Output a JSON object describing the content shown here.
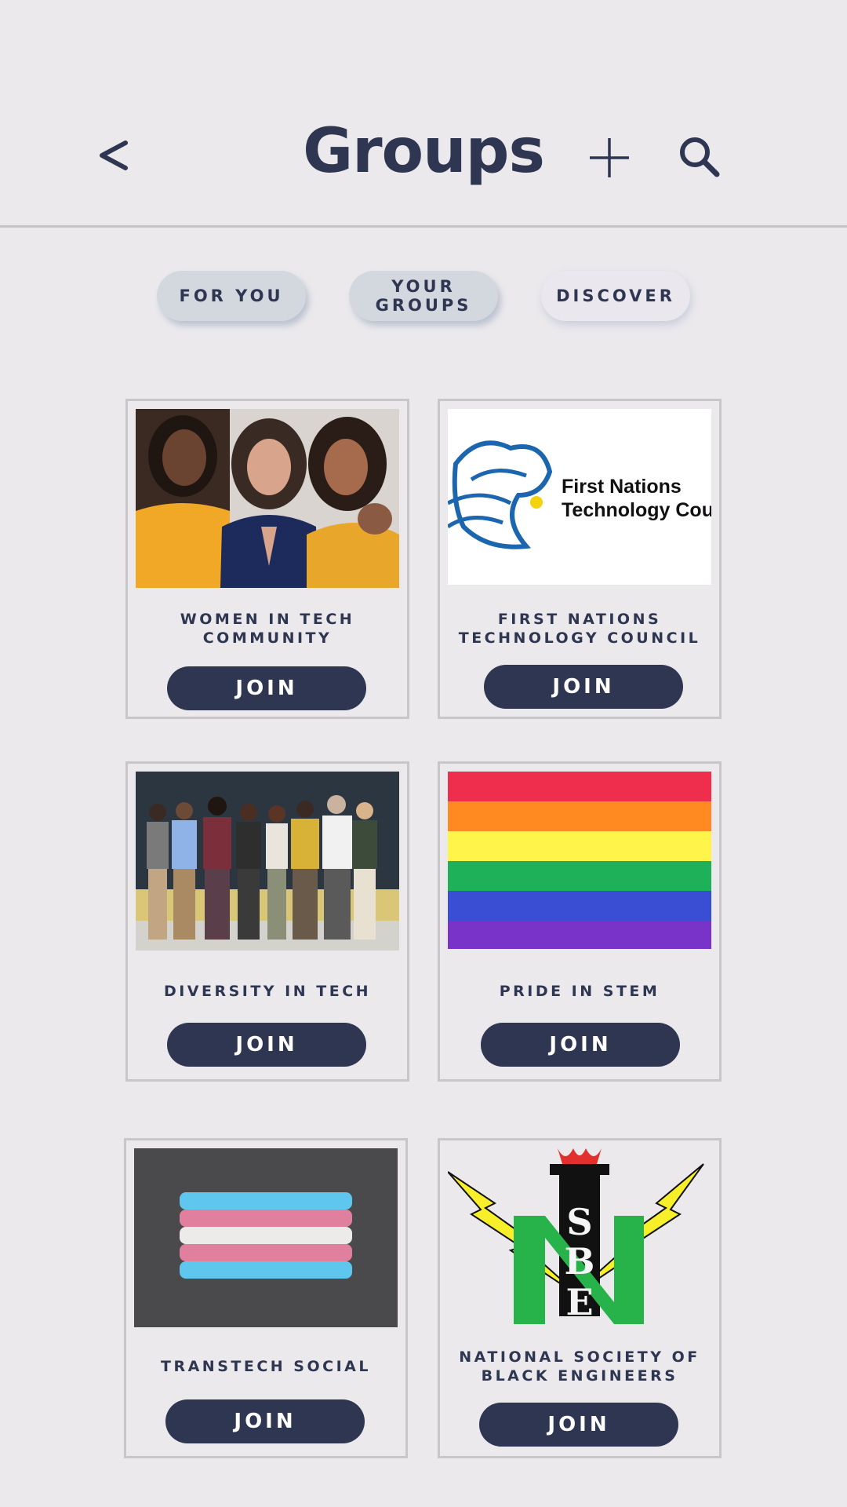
{
  "header": {
    "title": "Groups",
    "back_icon": "chevron-left-icon",
    "add_icon": "plus-icon",
    "search_icon": "search-icon"
  },
  "tabs": [
    {
      "label": "FOR YOU",
      "active": false
    },
    {
      "label": "YOUR\nGROUPS",
      "active": false
    },
    {
      "label": "DISCOVER",
      "active": true
    }
  ],
  "groups": [
    {
      "name": "WOMEN IN TECH\nCOMMUNITY",
      "join_label": "JOIN"
    },
    {
      "name": "FIRST NATIONS\nTECHNOLOGY COUNCIL",
      "join_label": "JOIN",
      "logo_text_1": "First Nations",
      "logo_text_2": "Technology Cou"
    },
    {
      "name": "DIVERSITY IN TECH",
      "join_label": "JOIN"
    },
    {
      "name": "PRIDE IN STEM",
      "join_label": "JOIN"
    },
    {
      "name": "TRANSTECH SOCIAL",
      "join_label": "JOIN"
    },
    {
      "name": "NATIONAL SOCIETY OF\nBLACK ENGINEERS",
      "join_label": "JOIN",
      "logo_letters": [
        "S",
        "B",
        "E"
      ],
      "logo_big_letter": "N"
    }
  ],
  "colors": {
    "background": "#ebe9ec",
    "primary": "#2e3651",
    "tab_bg": "#d3d8de"
  }
}
